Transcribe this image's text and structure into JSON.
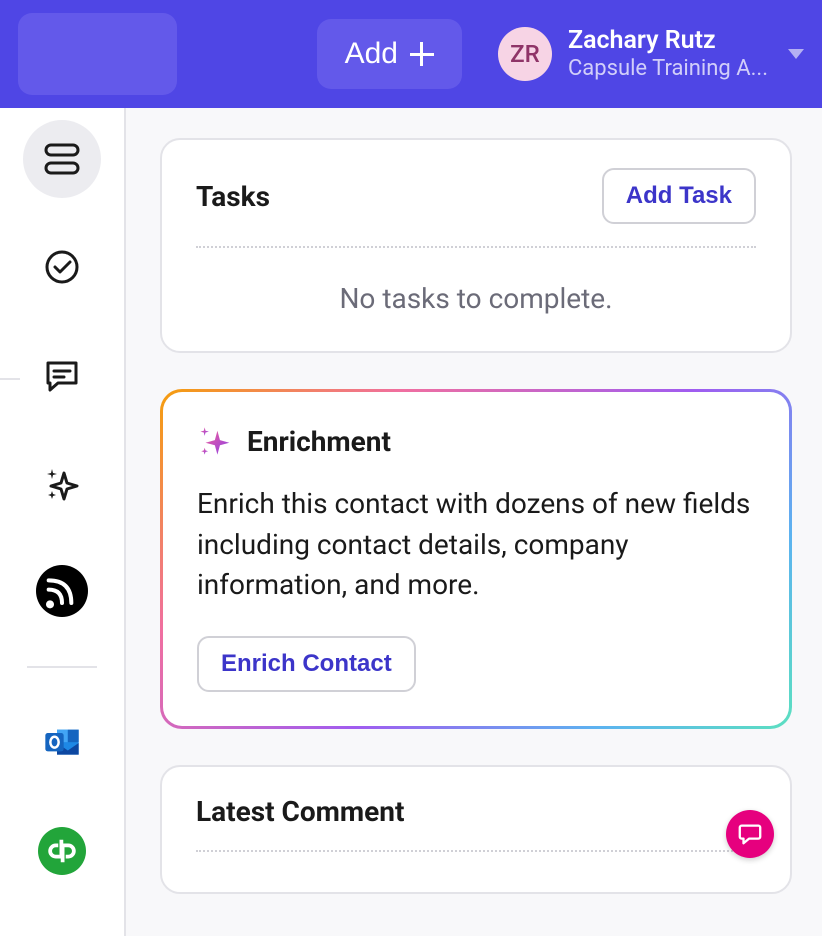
{
  "header": {
    "add_label": "Add",
    "user": {
      "initials": "ZR",
      "name": "Zachary Rutz",
      "org": "Capsule Training A..."
    }
  },
  "sidebar": {
    "items": [
      {
        "name": "records-icon"
      },
      {
        "name": "check-circle-icon"
      },
      {
        "name": "message-icon"
      },
      {
        "name": "sparkle-icon"
      },
      {
        "name": "feed-icon"
      }
    ],
    "integrations": [
      {
        "name": "outlook-icon"
      },
      {
        "name": "quickbooks-icon"
      }
    ]
  },
  "tasks": {
    "title": "Tasks",
    "add_button": "Add Task",
    "empty": "No tasks to complete."
  },
  "enrichment": {
    "title": "Enrichment",
    "description": "Enrich this contact with dozens of new fields including contact details, company information, and more.",
    "button": "Enrich Contact"
  },
  "comment": {
    "title": "Latest Comment"
  },
  "colors": {
    "primary": "#4f46e5",
    "accent_pink": "#e6007e"
  }
}
